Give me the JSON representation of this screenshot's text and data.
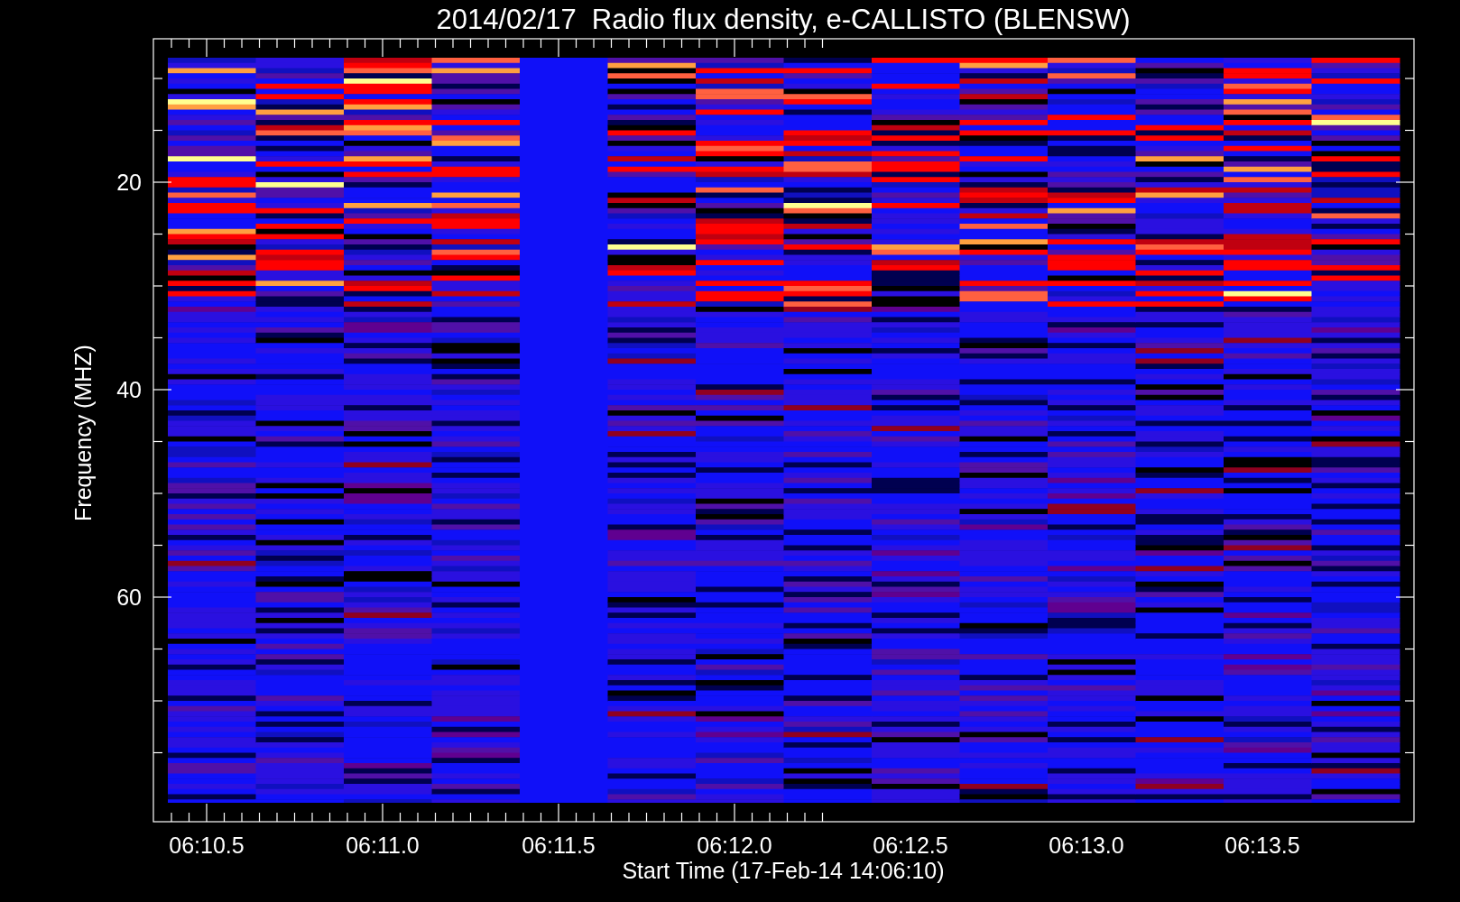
{
  "title": "2014/02/17  Radio flux density, e-CALLISTO (BLENSW)",
  "y_axis": {
    "label": "Frequency (MHZ)",
    "tick_labels": [
      "20",
      "40",
      "60"
    ]
  },
  "x_axis": {
    "label": "Start Time (17-Feb-14 14:06:10)",
    "tick_labels": [
      "06:10.5",
      "06:11.0",
      "06:11.5",
      "06:12.0",
      "06:12.5",
      "06:13.0",
      "06:13.5"
    ]
  }
}
